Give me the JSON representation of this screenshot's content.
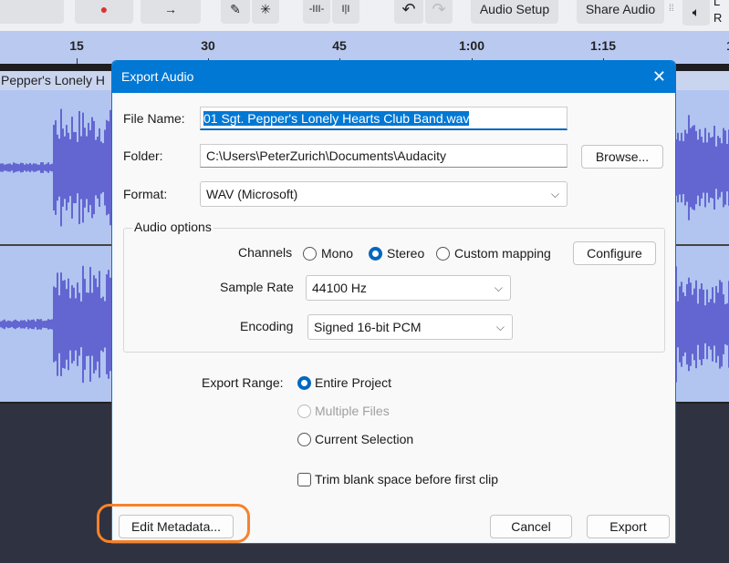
{
  "toolbar": {
    "audio_setup": "Audio Setup",
    "share_audio": "Share Audio",
    "icons": [
      "record-icon",
      "skip-end-icon",
      "pencil-icon",
      "multi-tool-icon",
      "trim-icon",
      "silence-icon",
      "undo-icon",
      "redo-icon",
      "speaker-icon"
    ],
    "meter_l": "L",
    "meter_r": "R"
  },
  "ruler": {
    "ticks": [
      "15",
      "30",
      "45",
      "1:00",
      "1:15",
      "1"
    ]
  },
  "track": {
    "clip_name": "Pepper's Lonely H",
    "waveform_color": "#6366d1",
    "background": "#b1c5f0"
  },
  "dialog": {
    "title": "Export Audio",
    "file_name_label": "File Name:",
    "file_name": "01 Sgt. Pepper's Lonely Hearts Club Band.wav",
    "folder_label": "Folder:",
    "folder": "C:\\Users\\PeterZurich\\Documents\\Audacity",
    "browse": "Browse...",
    "format_label": "Format:",
    "format": "WAV (Microsoft)",
    "audio_options": "Audio options",
    "channels_label": "Channels",
    "channels": [
      {
        "label": "Mono",
        "selected": false
      },
      {
        "label": "Stereo",
        "selected": true
      },
      {
        "label": "Custom mapping",
        "selected": false
      }
    ],
    "configure": "Configure",
    "sample_rate_label": "Sample Rate",
    "sample_rate": "44100 Hz",
    "encoding_label": "Encoding",
    "encoding": "Signed 16-bit PCM",
    "export_range_label": "Export Range:",
    "ranges": [
      {
        "label": "Entire Project",
        "selected": true,
        "enabled": true
      },
      {
        "label": "Multiple Files",
        "selected": false,
        "enabled": false
      },
      {
        "label": "Current Selection",
        "selected": false,
        "enabled": true
      }
    ],
    "trim_label": "Trim blank space before first clip",
    "trim_checked": false,
    "edit_metadata": "Edit Metadata...",
    "cancel": "Cancel",
    "export": "Export"
  },
  "accent": "#0078d4",
  "highlight_color": "#f7822a"
}
